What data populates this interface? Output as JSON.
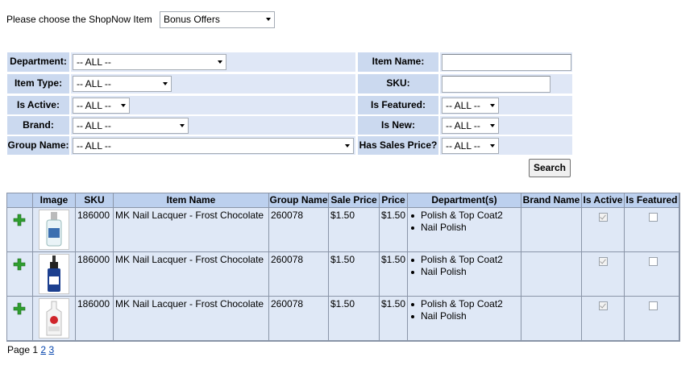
{
  "chooser": {
    "label": "Please choose the ShopNow Item",
    "value": "Bonus Offers"
  },
  "filters": {
    "department": {
      "label": "Department:",
      "value": "-- ALL --"
    },
    "item_type": {
      "label": "Item Type:",
      "value": "-- ALL --"
    },
    "is_active": {
      "label": "Is Active:",
      "value": "-- ALL --"
    },
    "brand": {
      "label": "Brand:",
      "value": "-- ALL --"
    },
    "group_name": {
      "label": "Group Name:",
      "value": "-- ALL --"
    },
    "item_name": {
      "label": "Item Name:",
      "value": ""
    },
    "sku": {
      "label": "SKU:",
      "value": ""
    },
    "is_featured": {
      "label": "Is Featured:",
      "value": "-- ALL --"
    },
    "is_new": {
      "label": "Is New:",
      "value": "-- ALL --"
    },
    "has_sales_price": {
      "label": "Has Sales Price?",
      "value": "-- ALL --"
    },
    "search_label": "Search"
  },
  "table": {
    "headers": [
      "",
      "Image",
      "SKU",
      "Item Name",
      "Group Name",
      "Sale Price",
      "Price",
      "Department(s)",
      "Brand Name",
      "Is Active",
      "Is Featured"
    ],
    "rows": [
      {
        "sku": "186000",
        "item_name": "MK Nail Lacquer - Frost Chocolate",
        "group_name": "260078",
        "sale_price": "$1.50",
        "price": "$1.50",
        "departments": [
          "Polish & Top Coat2",
          "Nail Polish"
        ],
        "brand_name": "",
        "is_active": true,
        "is_featured": false,
        "image_icon": "nail-polish-bottle-icon"
      },
      {
        "sku": "186000",
        "item_name": "MK Nail Lacquer - Frost Chocolate",
        "group_name": "260078",
        "sale_price": "$1.50",
        "price": "$1.50",
        "departments": [
          "Polish & Top Coat2",
          "Nail Polish"
        ],
        "brand_name": "",
        "is_active": true,
        "is_featured": false,
        "image_icon": "dropper-bottle-icon"
      },
      {
        "sku": "186000",
        "item_name": "MK Nail Lacquer - Frost Chocolate",
        "group_name": "260078",
        "sale_price": "$1.50",
        "price": "$1.50",
        "departments": [
          "Polish & Top Coat2",
          "Nail Polish"
        ],
        "brand_name": "",
        "is_active": true,
        "is_featured": false,
        "image_icon": "squeeze-bottle-icon"
      }
    ]
  },
  "pagination": {
    "label": "Page",
    "current": "1",
    "pages": [
      "2",
      "3"
    ]
  },
  "colors": {
    "header_bg": "#bcd0ee",
    "row_bg": "#dfe8f6",
    "label_bg": "#cbd9ef",
    "add_icon": "#2f9e2f"
  }
}
